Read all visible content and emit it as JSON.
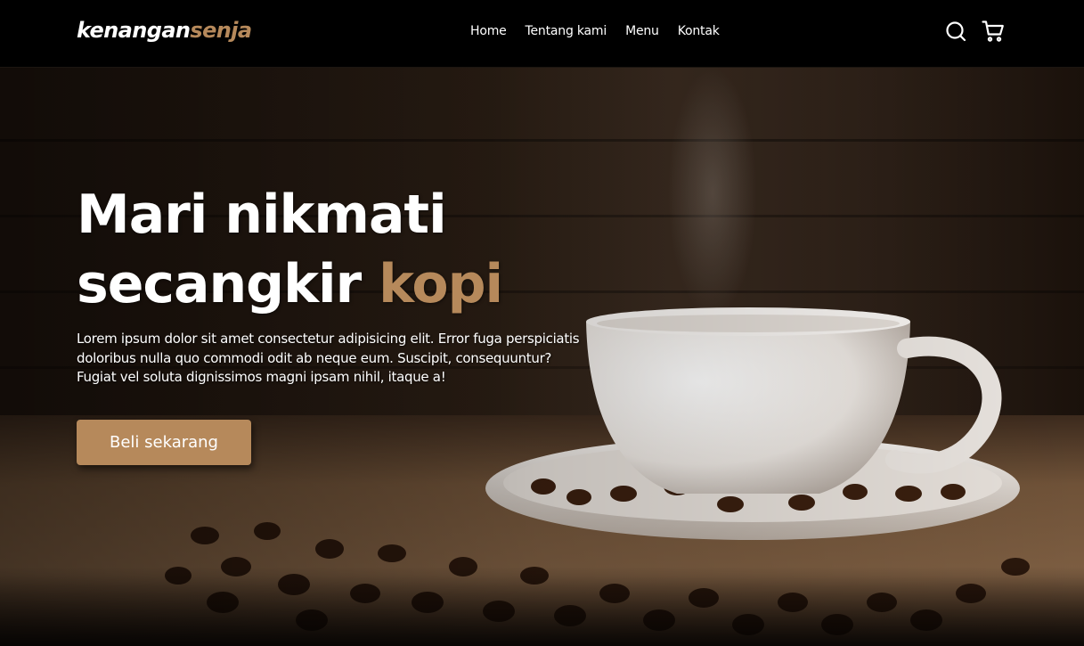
{
  "brand": {
    "name_part1": "kenangan",
    "name_part2": "senja",
    "accent_color": "#b6895b"
  },
  "nav": {
    "links": [
      {
        "label": "Home"
      },
      {
        "label": "Tentang kami"
      },
      {
        "label": "Menu"
      },
      {
        "label": "Kontak"
      }
    ],
    "icons": [
      "search-icon",
      "shopping-cart-icon"
    ]
  },
  "hero": {
    "title_line1": "Mari nikmati",
    "title_line2_prefix": "secangkir",
    "title_line2_accent": "kopi",
    "description_line1": "Lorem ipsum dolor sit amet consectetur adipisicing elit. Error fuga perspiciatis",
    "description_line2": "doloribus nulla quo commodi odit ab neque eum. Suscipit, consequuntur?",
    "description_line3": "Fugiat vel soluta dignissimos magni ipsam nihil, itaque a!",
    "cta_label": "Beli sekarang",
    "background_image": "coffee-cup-on-saucer-with-beans"
  }
}
